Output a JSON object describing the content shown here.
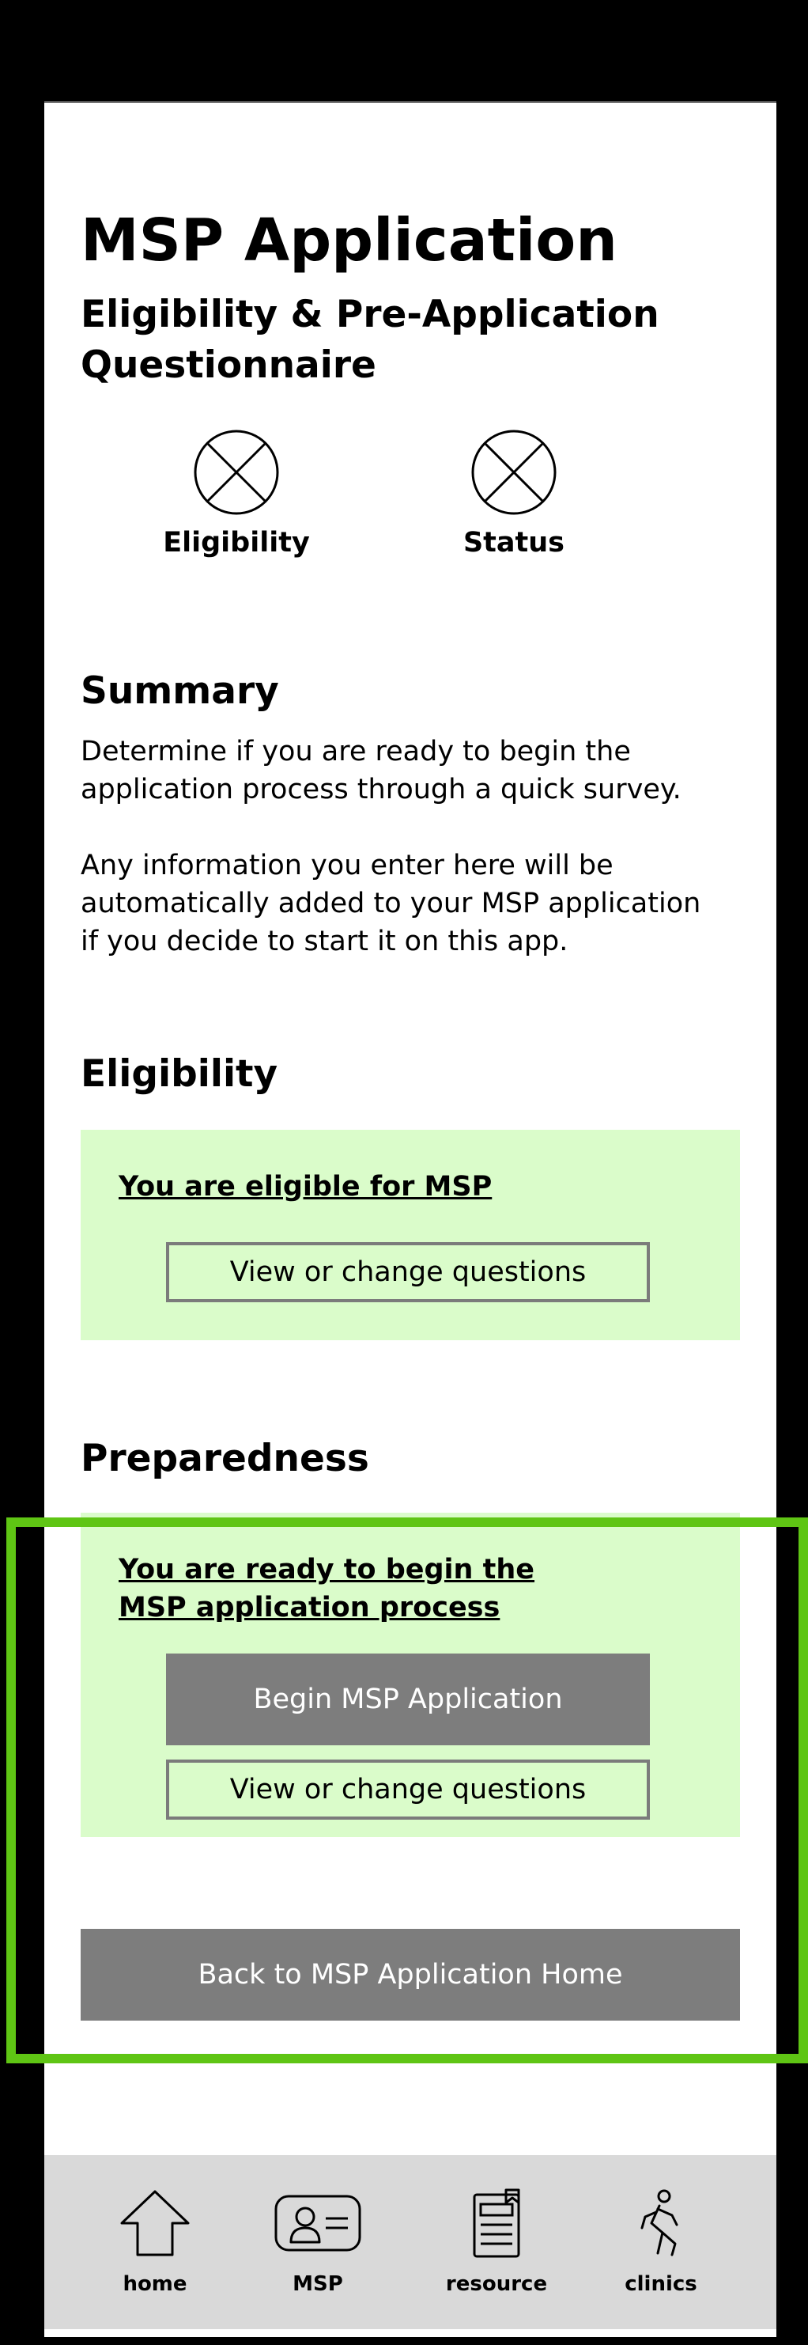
{
  "header": {
    "title": "MSP Application",
    "subtitle": "Eligibility & Pre-Application Questionnaire"
  },
  "status_indicators": [
    {
      "label": "Eligibility",
      "icon": "placeholder-x-icon"
    },
    {
      "label": "Status",
      "icon": "placeholder-x-icon"
    }
  ],
  "summary": {
    "heading": "Summary",
    "paragraph_1": "Determine if you are ready to begin the application process through a quick survey.",
    "paragraph_2": "Any information you enter here will be automatically added to your MSP application if you decide to start it on this app."
  },
  "eligibility": {
    "heading": "Eligibility",
    "message": "You are eligible for MSP",
    "change_button": "View or change questions"
  },
  "preparedness": {
    "heading": "Preparedness",
    "message": "You are ready to begin the MSP application process",
    "begin_button": "Begin MSP Application",
    "change_button": "View or change questions"
  },
  "back_button": "Back to MSP Application Home",
  "bottom_nav": [
    {
      "label": "home",
      "icon": "home-icon"
    },
    {
      "label": "MSP",
      "icon": "id-card-icon"
    },
    {
      "label": "resource",
      "icon": "document-icon"
    },
    {
      "label": "clinics",
      "icon": "running-person-icon"
    }
  ],
  "colors": {
    "card_background": "#dafcca",
    "button_gray": "#7d7d7d",
    "highlight_green": "#5fc514",
    "nav_background": "#d9d9d9"
  }
}
